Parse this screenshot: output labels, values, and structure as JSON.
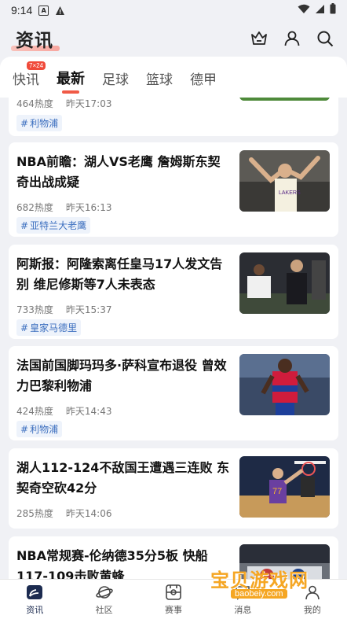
{
  "status_bar": {
    "time": "9:14"
  },
  "header": {
    "title": "资讯"
  },
  "tabs": [
    {
      "label": "快讯",
      "badge": "7×24"
    },
    {
      "label": "最新"
    },
    {
      "label": "足球"
    },
    {
      "label": "篮球"
    },
    {
      "label": "德甲"
    }
  ],
  "feed": [
    {
      "headline": "",
      "heat": "464热度",
      "time": "昨天17:03",
      "tag": "利物浦"
    },
    {
      "headline": "NBA前瞻：湖人VS老鹰 詹姆斯东契奇出战成疑",
      "heat": "682热度",
      "time": "昨天16:13",
      "tag": "亚特兰大老鹰"
    },
    {
      "headline": "阿斯报：阿隆索离任皇马17人发文告别 维尼修斯等7人未表态",
      "heat": "733热度",
      "time": "昨天15:37",
      "tag": "皇家马德里"
    },
    {
      "headline": "法国前国脚玛玛多·萨科宣布退役 曾效力巴黎利物浦",
      "heat": "424热度",
      "time": "昨天14:43",
      "tag": "利物浦"
    },
    {
      "headline": "湖人112-124不敌国王遭遇三连败 东契奇空砍42分",
      "heat": "285热度",
      "time": "昨天14:06",
      "tag": ""
    },
    {
      "headline": "NBA常规赛-伦纳德35分5板 快船117-109击败黄蜂",
      "heat": "",
      "time": "",
      "tag": ""
    }
  ],
  "bottom_nav": [
    {
      "label": "资讯",
      "icon": "news-icon"
    },
    {
      "label": "社区",
      "icon": "planet-icon"
    },
    {
      "label": "赛事",
      "icon": "schedule-icon"
    },
    {
      "label": "消息",
      "icon": "message-icon"
    },
    {
      "label": "我的",
      "icon": "profile-icon"
    }
  ],
  "watermark": {
    "text": "宝贝游戏网",
    "url": "baobeiy.com"
  },
  "colors": {
    "accent": "#f05a46",
    "tag_blue": "#3c6fbf",
    "nav_active": "#1c2b50"
  }
}
